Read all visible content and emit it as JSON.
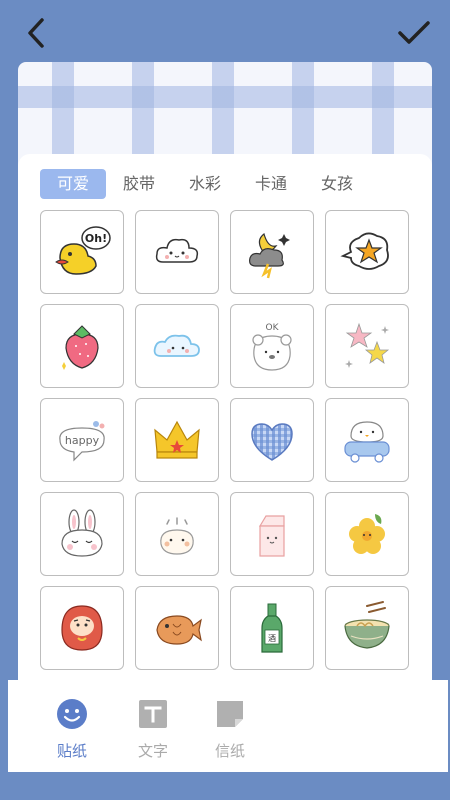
{
  "tabs": [
    "可爱",
    "胶带",
    "水彩",
    "卡通",
    "女孩"
  ],
  "selected_tab": "可爱",
  "stickers": [
    "oh-duck",
    "cloud-face",
    "moon-storm",
    "star-bubble",
    "strawberry",
    "cloud-blush",
    "ok-bear",
    "stars",
    "happy-bubble",
    "crown",
    "plaid-heart",
    "bird-car",
    "bunny",
    "hamster",
    "milk-carton",
    "yellow-flower",
    "daruma",
    "taiyaki",
    "sake-bottle",
    "ramen-bowl"
  ],
  "sticker_text": {
    "oh": "Oh!",
    "ok": "OK",
    "happy": "happy",
    "sake": "酒"
  },
  "bottom_nav": [
    {
      "label": "贴纸",
      "icon": "smiley-icon"
    },
    {
      "label": "文字",
      "icon": "text-t-icon"
    },
    {
      "label": "信纸",
      "icon": "letter-paper-icon"
    }
  ],
  "colors": {
    "background": "#6b8cc3",
    "accent": "#5b7dc8",
    "tab_active": "#9bb8ee"
  }
}
